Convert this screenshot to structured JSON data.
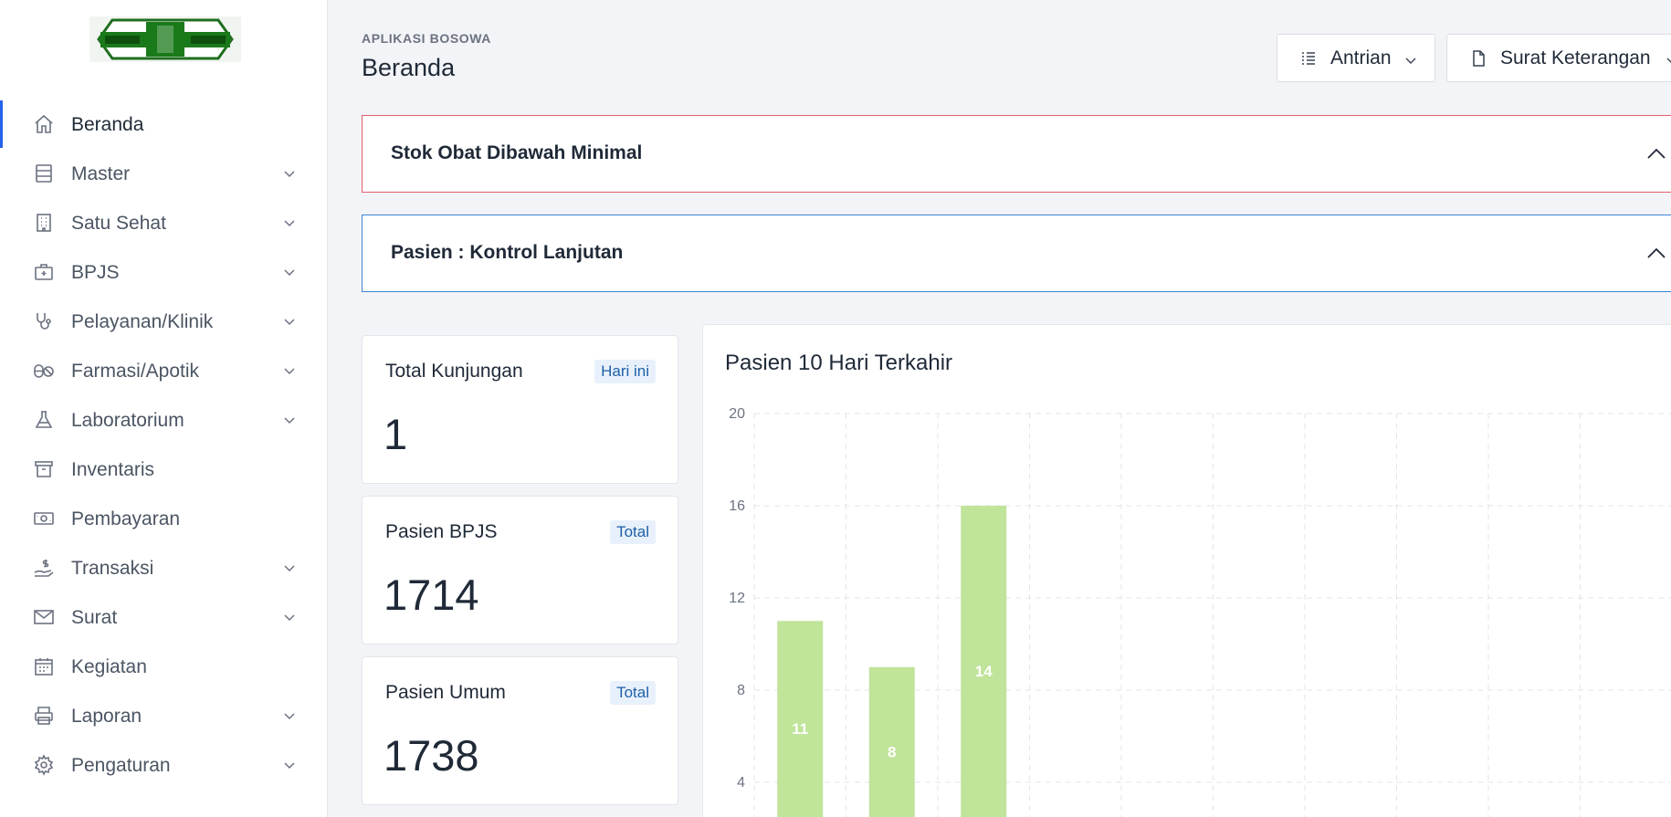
{
  "sidebar": {
    "items": [
      {
        "label": "Beranda",
        "icon": "home-icon",
        "active": true,
        "expandable": false
      },
      {
        "label": "Master",
        "icon": "database-icon",
        "active": false,
        "expandable": true
      },
      {
        "label": "Satu Sehat",
        "icon": "building-icon",
        "active": false,
        "expandable": true
      },
      {
        "label": "BPJS",
        "icon": "medical-kit-icon",
        "active": false,
        "expandable": true
      },
      {
        "label": "Pelayanan/Klinik",
        "icon": "stethoscope-icon",
        "active": false,
        "expandable": true
      },
      {
        "label": "Farmasi/Apotik",
        "icon": "pills-icon",
        "active": false,
        "expandable": true
      },
      {
        "label": "Laboratorium",
        "icon": "flask-icon",
        "active": false,
        "expandable": true
      },
      {
        "label": "Inventaris",
        "icon": "archive-icon",
        "active": false,
        "expandable": false
      },
      {
        "label": "Pembayaran",
        "icon": "cash-icon",
        "active": false,
        "expandable": false
      },
      {
        "label": "Transaksi",
        "icon": "hand-coin-icon",
        "active": false,
        "expandable": true
      },
      {
        "label": "Surat",
        "icon": "mail-icon",
        "active": false,
        "expandable": true
      },
      {
        "label": "Kegiatan",
        "icon": "calendar-icon",
        "active": false,
        "expandable": false
      },
      {
        "label": "Laporan",
        "icon": "printer-icon",
        "active": false,
        "expandable": true
      },
      {
        "label": "Pengaturan",
        "icon": "gear-icon",
        "active": false,
        "expandable": true
      }
    ]
  },
  "header": {
    "app_name": "APLIKASI BOSOWA",
    "title": "Beranda",
    "antrian_label": "Antrian",
    "surat_label": "Surat Keterangan"
  },
  "panels": {
    "stok_title": "Stok Obat Dibawah Minimal",
    "kontrol_title": "Pasien : Kontrol Lanjutan"
  },
  "stats": [
    {
      "label": "Total Kunjungan",
      "badge": "Hari ini",
      "value": "1"
    },
    {
      "label": "Pasien BPJS",
      "badge": "Total",
      "value": "1714"
    },
    {
      "label": "Pasien Umum",
      "badge": "Total",
      "value": "1738"
    }
  ],
  "colors": {
    "accent": "#2563eb",
    "alert_red": "#e35d6a",
    "alert_blue": "#3b82d6",
    "bar": "#c0e49a",
    "badge_bg": "#e8f1fb",
    "badge_text": "#1e5fa8"
  },
  "chart_data": {
    "type": "bar",
    "title": "Pasien 10 Hari Terkahir",
    "yticks": [
      20,
      16,
      12,
      8,
      4
    ],
    "ylim": [
      0,
      20
    ],
    "grid": true,
    "series": [
      {
        "values": [
          11,
          9,
          16
        ],
        "labels": [
          "11",
          "8",
          "14"
        ]
      }
    ]
  }
}
